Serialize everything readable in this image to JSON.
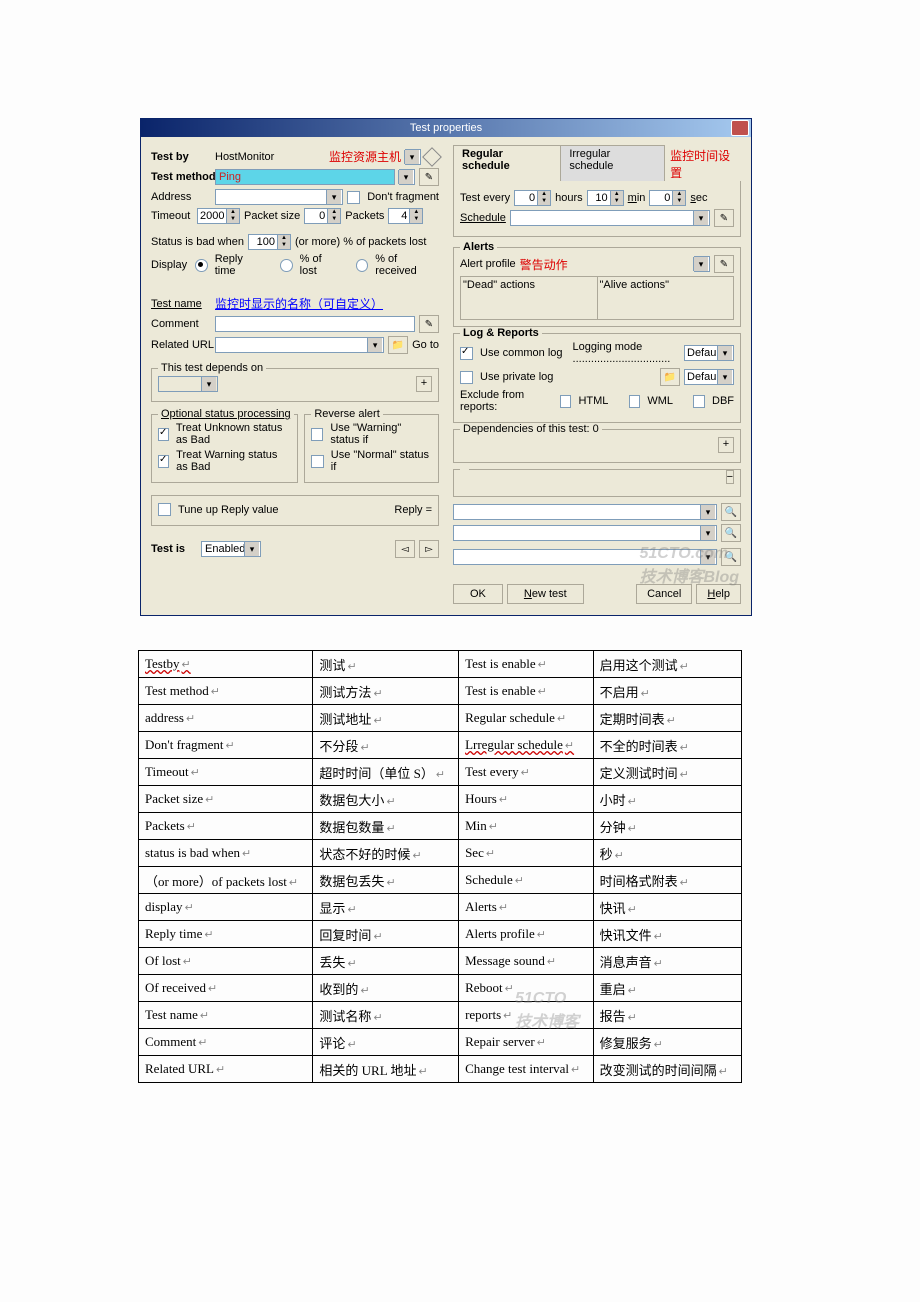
{
  "dialog": {
    "title": "Test properties",
    "left": {
      "test_by_label": "Test by",
      "test_by_value": "HostMonitor",
      "test_by_red": "监控资源主机",
      "test_method_label": "Test method",
      "test_method_value": "Ping",
      "address_label": "Address",
      "dont_fragment": "Don't fragment",
      "timeout_label": "Timeout",
      "timeout_value": "2000",
      "packet_size_label": "Packet size",
      "packet_size_value": "0",
      "packets_label": "Packets",
      "packets_value": "4",
      "status_bad_label": "Status is bad when",
      "status_bad_value": "100",
      "status_bad_suffix": "(or more) % of packets lost",
      "display_label": "Display",
      "display_opts": [
        "Reply time",
        "% of lost",
        "% of received"
      ],
      "test_name_label": "Test name",
      "test_name_red": "监控时显示的名称（可自定义）",
      "comment_label": "Comment",
      "related_url_label": "Related URL",
      "goto": "Go to",
      "depends_label": "This test depends on",
      "optional_header": "Optional status processing",
      "treat_unknown": "Treat Unknown status as Bad",
      "treat_warning": "Treat Warning status as Bad",
      "tune_reply": "Tune up Reply value",
      "reverse_header": "Reverse alert",
      "use_warning_if": "Use \"Warning\" status if",
      "use_normal_if": "Use \"Normal\" status if",
      "reply_eq": "Reply =",
      "test_is": "Test is",
      "test_is_value": "Enabled"
    },
    "right": {
      "reg_tab": "Regular schedule",
      "irreg_tab": "Irregular schedule",
      "sched_red": "监控时间设置",
      "test_every": "Test every",
      "test_every_h": "0",
      "hours": "hours",
      "test_every_m": "10",
      "min": "min",
      "test_every_s": "0",
      "sec": "sec",
      "schedule_label": "Schedule",
      "alerts_header": "Alerts",
      "alert_profile": "Alert profile",
      "alert_red": "警告动作",
      "dead_actions": "\"Dead\" actions",
      "alive_actions": "\"Alive actions\"",
      "log_header": "Log & Reports",
      "use_common": "Use common log",
      "logging_mode": "Logging mode ................................",
      "default": "Default",
      "use_private": "Use private log",
      "exclude": "Exclude from reports:",
      "html": "HTML",
      "wml": "WML",
      "dbf": "DBF",
      "deps_label": "Dependencies of this test: 0"
    },
    "buttons": {
      "ok": "OK",
      "new_test": "New test",
      "cancel": "Cancel",
      "help": "Help"
    },
    "watermark": "51CTO.com\n技术博客Blog"
  },
  "table": [
    [
      "Testby",
      "测试",
      "Test is enable",
      "启用这个测试"
    ],
    [
      "Test method",
      "测试方法",
      "Test is enable",
      "不启用"
    ],
    [
      "address",
      "测试地址",
      "Regular schedule",
      "定期时间表"
    ],
    [
      "Don't fragment",
      "不分段",
      "Lrregular schedule",
      "不全的时间表"
    ],
    [
      "Timeout",
      "超时时间（单位 S）",
      "Test every",
      "定义测试时间"
    ],
    [
      "Packet size",
      "数据包大小",
      "Hours",
      "小时"
    ],
    [
      "Packets",
      "数据包数量",
      "Min",
      "分钟"
    ],
    [
      "status is bad when",
      "状态不好的时候",
      "Sec",
      "秒"
    ],
    [
      "（or more）of packets lost",
      "数据包丢失",
      "Schedule",
      "时间格式附表"
    ],
    [
      "display",
      "显示",
      "Alerts",
      "快讯"
    ],
    [
      "Reply time",
      "回复时间",
      "Alerts profile",
      "快讯文件"
    ],
    [
      "Of   lost",
      "丢失",
      "Message sound",
      "消息声音"
    ],
    [
      "Of received",
      "收到的",
      "Reboot",
      "重启"
    ],
    [
      "Test name",
      "测试名称",
      "reports",
      "报告"
    ],
    [
      "Comment",
      "评论",
      "Repair server",
      "修复服务"
    ],
    [
      "Related   URL",
      "相关的 URL 地址",
      "Change       test interval",
      "改变测试的时间间隔"
    ]
  ]
}
